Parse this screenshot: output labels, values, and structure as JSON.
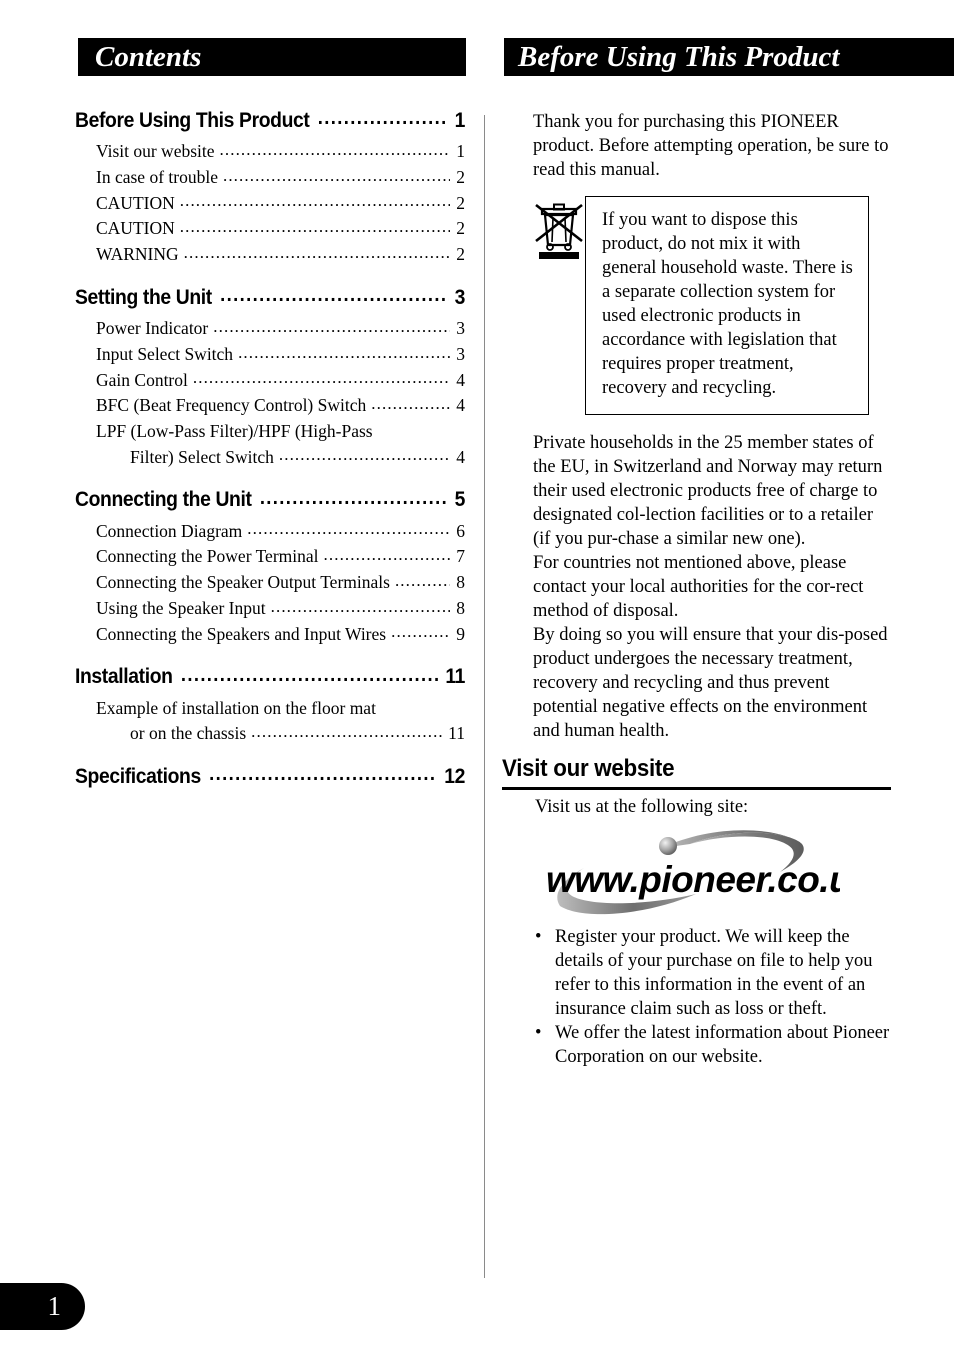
{
  "left_header": {
    "title": "Contents"
  },
  "right_header": {
    "title": "Before Using This Product"
  },
  "toc": {
    "groups": [
      {
        "title": "Before Using This Product",
        "page": "1",
        "entries": [
          {
            "label": "Visit our website",
            "page": "1"
          },
          {
            "label": "In case of trouble",
            "page": "2"
          },
          {
            "label": "CAUTION",
            "page": "2"
          },
          {
            "label": "CAUTION",
            "page": "2"
          },
          {
            "label": "WARNING",
            "page": "2"
          }
        ]
      },
      {
        "title": "Setting the Unit",
        "page": "3",
        "entries": [
          {
            "label": "Power Indicator",
            "page": "3"
          },
          {
            "label": "Input Select Switch",
            "page": "3"
          },
          {
            "label": "Gain Control",
            "page": "4"
          },
          {
            "label": "BFC (Beat Frequency Control) Switch",
            "page": "4"
          },
          {
            "label": "LPF (Low-Pass Filter)/HPF (High-Pass",
            "label2": "Filter) Select Switch",
            "page": "4"
          }
        ]
      },
      {
        "title": "Connecting the Unit",
        "page": "5",
        "entries": [
          {
            "label": "Connection Diagram",
            "page": "6"
          },
          {
            "label": "Connecting the Power Terminal",
            "page": "7"
          },
          {
            "label": "Connecting the Speaker Output Terminals",
            "page": "8"
          },
          {
            "label": "Using the Speaker Input",
            "page": "8"
          },
          {
            "label": "Connecting the Speakers and Input Wires",
            "page": "9"
          }
        ]
      },
      {
        "title": "Installation",
        "page": "11",
        "entries": [
          {
            "label": "Example of installation on the floor mat",
            "label2": "or on the chassis",
            "page": "11"
          }
        ]
      },
      {
        "title": "Specifications",
        "page": "12",
        "entries": []
      }
    ],
    "dot_leader": "................................................................................................"
  },
  "right": {
    "intro": "Thank you for purchasing this PIONEER product. Before attempting operation, be sure to read this manual.",
    "weee_notice": "If you want to dispose this product, do not mix it with general household waste. There is a separate collection system for used electronic products in accordance with legislation that requires proper treatment, recovery and recycling.",
    "disposal_paragraphs": [
      "Private households in the 25 member states of the EU, in Switzerland and Norway may return their used electronic products free of charge to designated col-lection facilities or to a retailer (if you pur-chase a similar new one).",
      "For countries not mentioned above, please contact your local authorities for the cor-rect method of disposal.",
      "By doing so you will ensure that your dis-posed product undergoes the necessary treatment, recovery and recycling and thus prevent potential negative effects on the environment and human health."
    ],
    "website_heading": "Visit our website",
    "website_intro": "Visit us at the following site:",
    "website_logo_text": "www.pioneer.co.uk",
    "bullets": [
      {
        "marker": "•",
        "text": "Register your product. We will keep the details of your purchase on file to help you refer to this information in the event of an insurance claim such as loss or theft."
      },
      {
        "marker": "•",
        "text": "We offer the latest information about Pioneer Corporation on our website."
      }
    ]
  },
  "footer": {
    "page_number": "1"
  },
  "colors": {
    "ink": "#000000",
    "paper": "#ffffff",
    "rule": "#8a8a8a",
    "logo_gray": "#6e6e6e"
  }
}
